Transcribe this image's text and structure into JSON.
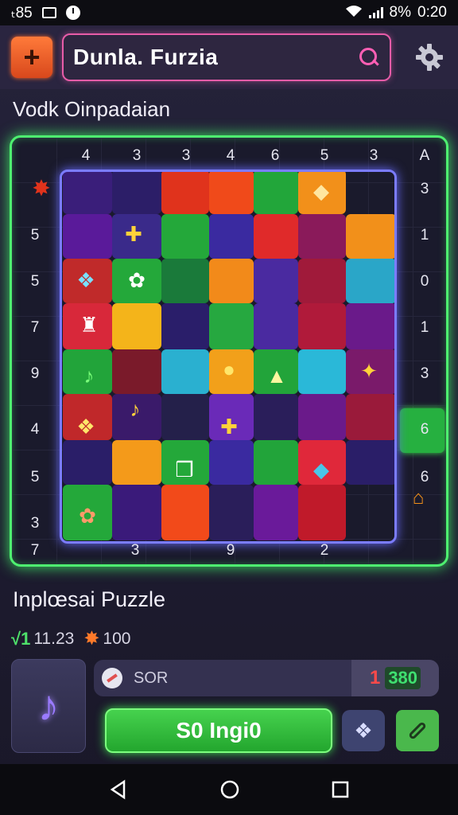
{
  "status_bar": {
    "left_text": "ₜ85",
    "battery": "8%",
    "time": "0:20"
  },
  "header": {
    "add_symbol": "+",
    "search_value": "Dunla. Furzia"
  },
  "section_title": "Vodk Oinpadaian",
  "board": {
    "top_clues": [
      "4",
      "3",
      "3",
      "4",
      "6",
      "5",
      "3",
      "A"
    ],
    "left_clues": [
      "5",
      "5",
      "7",
      "9",
      "4",
      "5",
      "3",
      "7"
    ],
    "right_clues": [
      "3",
      "1",
      "0",
      "1",
      "3",
      "6",
      "6"
    ],
    "bottom_clues": [
      "3",
      "9",
      "2"
    ]
  },
  "puzzle_title": "Inplœsai Puzzle",
  "stats": {
    "check": "√1",
    "value": "11.23",
    "stars": "100"
  },
  "progress": {
    "label": "SOR",
    "count": "1",
    "score": "380"
  },
  "solve_button": "S0 Ingi0",
  "colors": {
    "accent_green": "#4ef070",
    "accent_pink": "#e75ca8",
    "board_frame": "#7b7cff"
  }
}
